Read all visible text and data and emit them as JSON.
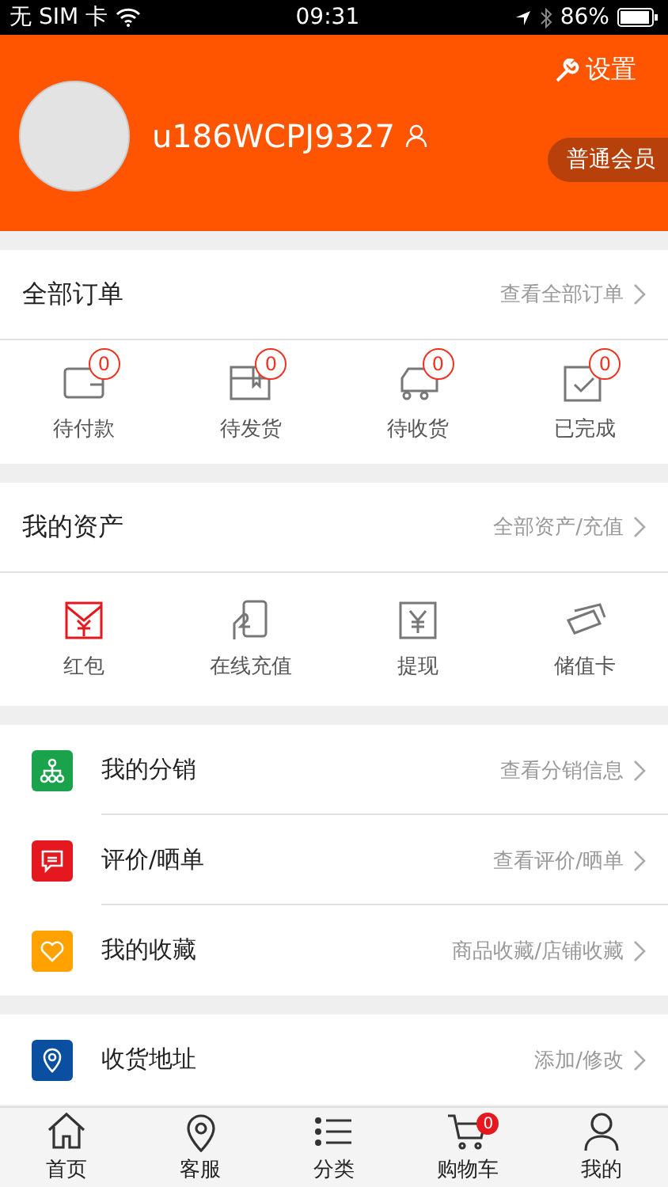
{
  "status_bar": {
    "carrier": "无 SIM 卡",
    "time": "09:31",
    "battery": "86%"
  },
  "profile": {
    "settings": "设置",
    "username": "u186WCPJ9327",
    "member_level": "普通会员"
  },
  "orders": {
    "title": "全部订单",
    "link": "查看全部订单",
    "items": [
      {
        "kind": "wallet",
        "label": "待付款",
        "count": "0"
      },
      {
        "kind": "box",
        "label": "待发货",
        "count": "0"
      },
      {
        "kind": "truck",
        "label": "待收货",
        "count": "0"
      },
      {
        "kind": "check",
        "label": "已完成",
        "count": "0"
      }
    ]
  },
  "assets": {
    "title": "我的资产",
    "link": "全部资产/充值",
    "items": [
      {
        "kind": "envelope",
        "label": "红包"
      },
      {
        "kind": "phone",
        "label": "在线充值"
      },
      {
        "kind": "cash",
        "label": "提现"
      },
      {
        "kind": "cards",
        "label": "储值卡"
      }
    ]
  },
  "menu_groups": [
    [
      {
        "kind": "network",
        "color": "#1aa34a",
        "label": "我的分销",
        "link": "查看分销信息"
      },
      {
        "kind": "comment",
        "color": "#e5171f",
        "label": "评价/晒单",
        "link": "查看评价/晒单"
      },
      {
        "kind": "heart",
        "color": "#ffa200",
        "label": "我的收藏",
        "link": "商品收藏/店铺收藏"
      }
    ],
    [
      {
        "kind": "pin",
        "color": "#0a4fa0",
        "label": "收货地址",
        "link": "添加/修改"
      }
    ]
  ],
  "tab_bar": [
    {
      "kind": "home",
      "label": "首页"
    },
    {
      "kind": "pin",
      "label": "客服"
    },
    {
      "kind": "list",
      "label": "分类"
    },
    {
      "kind": "cart",
      "label": "购物车",
      "badge": "0"
    },
    {
      "kind": "user",
      "label": "我的"
    }
  ]
}
